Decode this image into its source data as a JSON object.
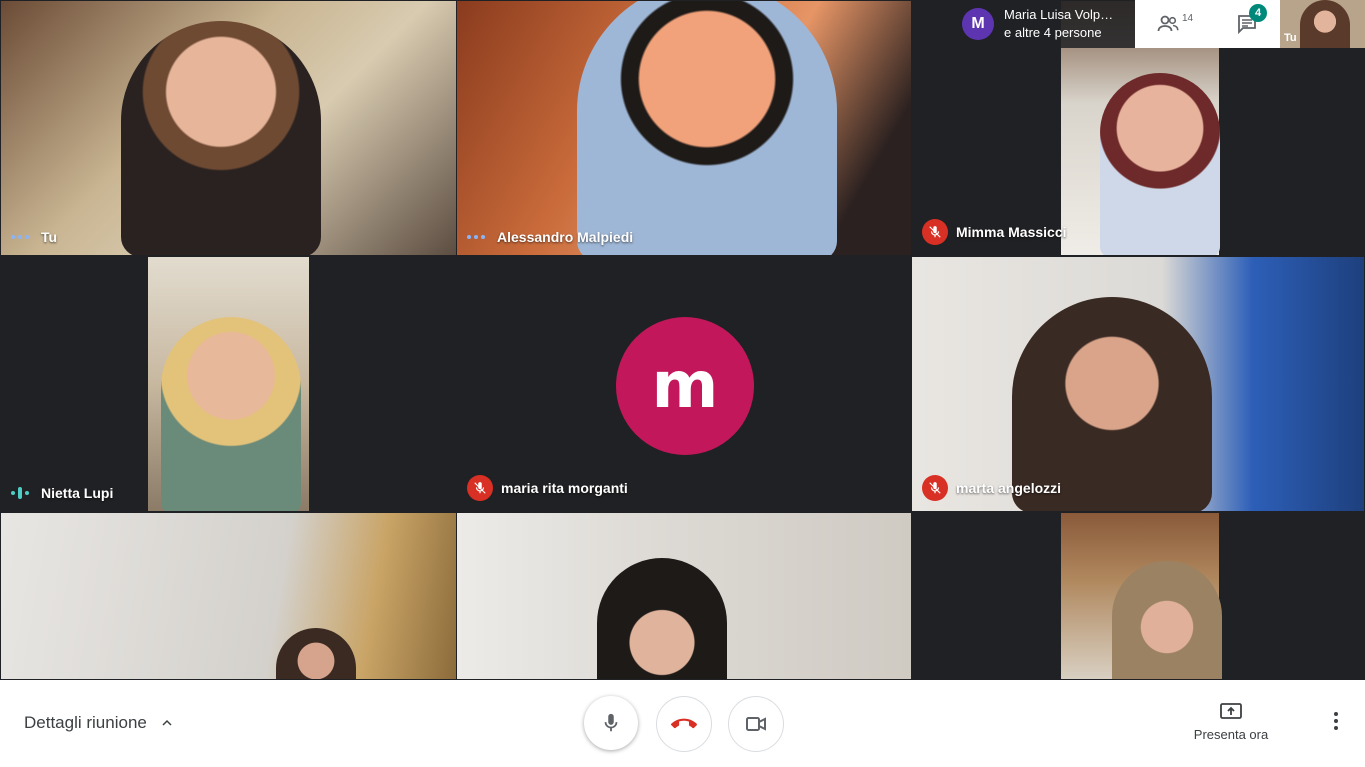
{
  "tiles": [
    {
      "name": "Tu",
      "status": "speaking"
    },
    {
      "name": "Alessandro Malpiedi",
      "status": "speaking"
    },
    {
      "name": "Mimma Massicci",
      "status": "muted"
    },
    {
      "name": "Nietta Lupi",
      "status": "talking"
    },
    {
      "name": "maria rita morganti",
      "status": "muted",
      "avatar_letter": "m"
    },
    {
      "name": "marta angelozzi",
      "status": "muted"
    }
  ],
  "topbar": {
    "avatar_letter": "M",
    "line1": "Maria Luisa Volp…",
    "line2": "e altre 4 persone",
    "people_count": "14",
    "chat_badge": "4",
    "self_label": "Tu"
  },
  "bottombar": {
    "details_label": "Dettagli riunione",
    "present_label": "Presenta ora"
  },
  "colors": {
    "avatar_bg": "#c2185b",
    "muted_red": "#d93025",
    "badge_teal": "#00897b"
  }
}
